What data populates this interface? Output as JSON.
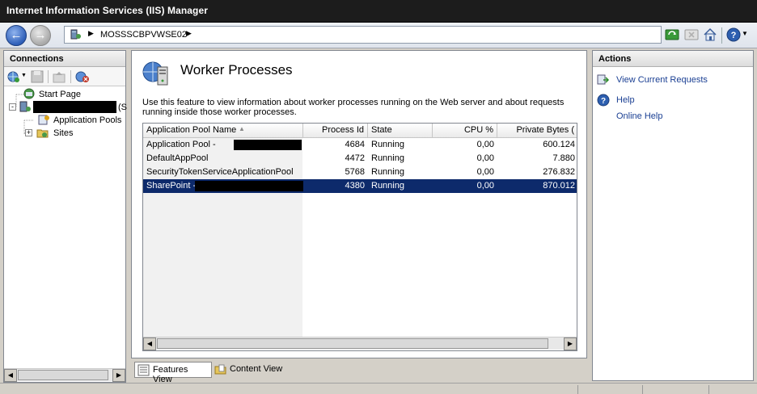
{
  "window": {
    "title": "Internet Information Services (IIS) Manager"
  },
  "address": {
    "server": "MOSSSCBPVWSE02"
  },
  "connections": {
    "header": "Connections",
    "tree": [
      {
        "label": "Start Page"
      },
      {
        "label": "(S"
      },
      {
        "label": "Application Pools"
      },
      {
        "label": "Sites"
      }
    ]
  },
  "feature": {
    "title": "Worker Processes",
    "description": "Use this feature to view information about worker processes running on the Web server and about requests running inside those worker processes."
  },
  "grid": {
    "columns": [
      "Application Pool Name",
      "Process Id",
      "State",
      "CPU %",
      "Private Bytes ("
    ],
    "rows": [
      {
        "name": "Application Pool -",
        "pid": "4684",
        "state": "Running",
        "cpu": "0,00",
        "bytes": "600.124"
      },
      {
        "name": "DefaultAppPool",
        "pid": "4472",
        "state": "Running",
        "cpu": "0,00",
        "bytes": "7.880"
      },
      {
        "name": "SecurityTokenServiceApplicationPool",
        "pid": "5768",
        "state": "Running",
        "cpu": "0,00",
        "bytes": "276.832"
      },
      {
        "name": "SharePoint -",
        "pid": "4380",
        "state": "Running",
        "cpu": "0,00",
        "bytes": "870.012"
      }
    ],
    "selected_row": 3
  },
  "view_tabs": {
    "features": "Features View",
    "content": "Content View"
  },
  "actions": {
    "header": "Actions",
    "view_requests": "View Current Requests",
    "help": "Help",
    "online_help": "Online Help"
  },
  "colors": {
    "selection": "#0d2a6b",
    "link": "#1a3f93",
    "titlebar": "#1c1c1c"
  }
}
